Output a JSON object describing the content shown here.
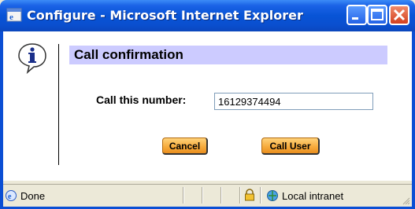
{
  "window": {
    "title": "Configure - Microsoft Internet Explorer",
    "controls": [
      "minimize-icon",
      "maximize-icon",
      "close-icon"
    ]
  },
  "dialog": {
    "icon": "info-icon",
    "heading": "Call confirmation",
    "heading_band_color": "#cccbff",
    "field_label": "Call this number:",
    "phone_value": "16129374494",
    "buttons": {
      "cancel": "Cancel",
      "call_user": "Call User"
    }
  },
  "statusbar": {
    "status": "Done",
    "zone": "Local intranet",
    "icons": [
      "ie-page-icon",
      "lock-icon",
      "intranet-icon"
    ]
  },
  "colors": {
    "titlebar": "#0854d6",
    "button": "#f6a93a",
    "frame": "#ece9d8"
  }
}
